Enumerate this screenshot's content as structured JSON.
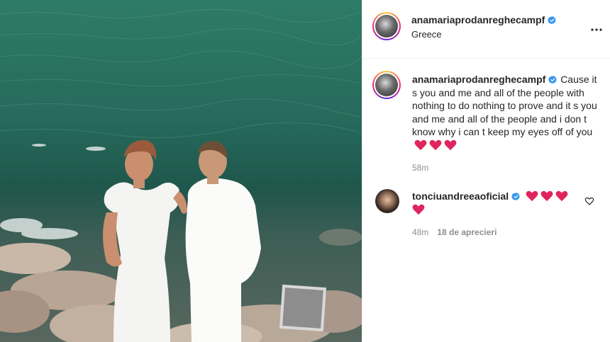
{
  "post": {
    "author": "anamariaprodanreghecampf",
    "location": "Greece",
    "verified": true
  },
  "caption": {
    "author": "anamariaprodanreghecampf",
    "text": "Cause it s you and me and all of the people with nothing to do nothing to prove and it s you and me and all of the people and i don t know why i can t keep my eyes off of you",
    "emojis": [
      "red-heart",
      "red-heart",
      "red-heart"
    ],
    "time": "58m"
  },
  "comment": {
    "author": "tonciuandreeaoficial",
    "emojis": [
      "red-heart",
      "red-heart",
      "red-heart",
      "red-heart"
    ],
    "time": "48m",
    "likes": "18 de aprecieri"
  },
  "colors": {
    "verified": "#3897f0",
    "heart": "#e0245e",
    "meta": "#8e8e8e",
    "text": "#262626"
  },
  "icons": [
    "more-options-icon",
    "verified-badge-icon",
    "red-heart-emoji",
    "like-heart-icon"
  ]
}
